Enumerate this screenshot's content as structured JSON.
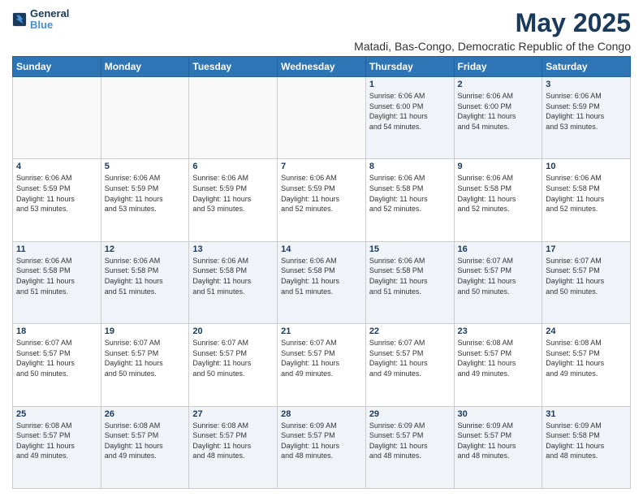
{
  "header": {
    "logo_line1": "General",
    "logo_line2": "Blue",
    "month": "May 2025",
    "location": "Matadi, Bas-Congo, Democratic Republic of the Congo"
  },
  "days_of_week": [
    "Sunday",
    "Monday",
    "Tuesday",
    "Wednesday",
    "Thursday",
    "Friday",
    "Saturday"
  ],
  "weeks": [
    [
      {
        "num": "",
        "info": ""
      },
      {
        "num": "",
        "info": ""
      },
      {
        "num": "",
        "info": ""
      },
      {
        "num": "",
        "info": ""
      },
      {
        "num": "1",
        "info": "Sunrise: 6:06 AM\nSunset: 6:00 PM\nDaylight: 11 hours\nand 54 minutes."
      },
      {
        "num": "2",
        "info": "Sunrise: 6:06 AM\nSunset: 6:00 PM\nDaylight: 11 hours\nand 54 minutes."
      },
      {
        "num": "3",
        "info": "Sunrise: 6:06 AM\nSunset: 5:59 PM\nDaylight: 11 hours\nand 53 minutes."
      }
    ],
    [
      {
        "num": "4",
        "info": "Sunrise: 6:06 AM\nSunset: 5:59 PM\nDaylight: 11 hours\nand 53 minutes."
      },
      {
        "num": "5",
        "info": "Sunrise: 6:06 AM\nSunset: 5:59 PM\nDaylight: 11 hours\nand 53 minutes."
      },
      {
        "num": "6",
        "info": "Sunrise: 6:06 AM\nSunset: 5:59 PM\nDaylight: 11 hours\nand 53 minutes."
      },
      {
        "num": "7",
        "info": "Sunrise: 6:06 AM\nSunset: 5:59 PM\nDaylight: 11 hours\nand 52 minutes."
      },
      {
        "num": "8",
        "info": "Sunrise: 6:06 AM\nSunset: 5:58 PM\nDaylight: 11 hours\nand 52 minutes."
      },
      {
        "num": "9",
        "info": "Sunrise: 6:06 AM\nSunset: 5:58 PM\nDaylight: 11 hours\nand 52 minutes."
      },
      {
        "num": "10",
        "info": "Sunrise: 6:06 AM\nSunset: 5:58 PM\nDaylight: 11 hours\nand 52 minutes."
      }
    ],
    [
      {
        "num": "11",
        "info": "Sunrise: 6:06 AM\nSunset: 5:58 PM\nDaylight: 11 hours\nand 51 minutes."
      },
      {
        "num": "12",
        "info": "Sunrise: 6:06 AM\nSunset: 5:58 PM\nDaylight: 11 hours\nand 51 minutes."
      },
      {
        "num": "13",
        "info": "Sunrise: 6:06 AM\nSunset: 5:58 PM\nDaylight: 11 hours\nand 51 minutes."
      },
      {
        "num": "14",
        "info": "Sunrise: 6:06 AM\nSunset: 5:58 PM\nDaylight: 11 hours\nand 51 minutes."
      },
      {
        "num": "15",
        "info": "Sunrise: 6:06 AM\nSunset: 5:58 PM\nDaylight: 11 hours\nand 51 minutes."
      },
      {
        "num": "16",
        "info": "Sunrise: 6:07 AM\nSunset: 5:57 PM\nDaylight: 11 hours\nand 50 minutes."
      },
      {
        "num": "17",
        "info": "Sunrise: 6:07 AM\nSunset: 5:57 PM\nDaylight: 11 hours\nand 50 minutes."
      }
    ],
    [
      {
        "num": "18",
        "info": "Sunrise: 6:07 AM\nSunset: 5:57 PM\nDaylight: 11 hours\nand 50 minutes."
      },
      {
        "num": "19",
        "info": "Sunrise: 6:07 AM\nSunset: 5:57 PM\nDaylight: 11 hours\nand 50 minutes."
      },
      {
        "num": "20",
        "info": "Sunrise: 6:07 AM\nSunset: 5:57 PM\nDaylight: 11 hours\nand 50 minutes."
      },
      {
        "num": "21",
        "info": "Sunrise: 6:07 AM\nSunset: 5:57 PM\nDaylight: 11 hours\nand 49 minutes."
      },
      {
        "num": "22",
        "info": "Sunrise: 6:07 AM\nSunset: 5:57 PM\nDaylight: 11 hours\nand 49 minutes."
      },
      {
        "num": "23",
        "info": "Sunrise: 6:08 AM\nSunset: 5:57 PM\nDaylight: 11 hours\nand 49 minutes."
      },
      {
        "num": "24",
        "info": "Sunrise: 6:08 AM\nSunset: 5:57 PM\nDaylight: 11 hours\nand 49 minutes."
      }
    ],
    [
      {
        "num": "25",
        "info": "Sunrise: 6:08 AM\nSunset: 5:57 PM\nDaylight: 11 hours\nand 49 minutes."
      },
      {
        "num": "26",
        "info": "Sunrise: 6:08 AM\nSunset: 5:57 PM\nDaylight: 11 hours\nand 49 minutes."
      },
      {
        "num": "27",
        "info": "Sunrise: 6:08 AM\nSunset: 5:57 PM\nDaylight: 11 hours\nand 48 minutes."
      },
      {
        "num": "28",
        "info": "Sunrise: 6:09 AM\nSunset: 5:57 PM\nDaylight: 11 hours\nand 48 minutes."
      },
      {
        "num": "29",
        "info": "Sunrise: 6:09 AM\nSunset: 5:57 PM\nDaylight: 11 hours\nand 48 minutes."
      },
      {
        "num": "30",
        "info": "Sunrise: 6:09 AM\nSunset: 5:57 PM\nDaylight: 11 hours\nand 48 minutes."
      },
      {
        "num": "31",
        "info": "Sunrise: 6:09 AM\nSunset: 5:58 PM\nDaylight: 11 hours\nand 48 minutes."
      }
    ]
  ]
}
